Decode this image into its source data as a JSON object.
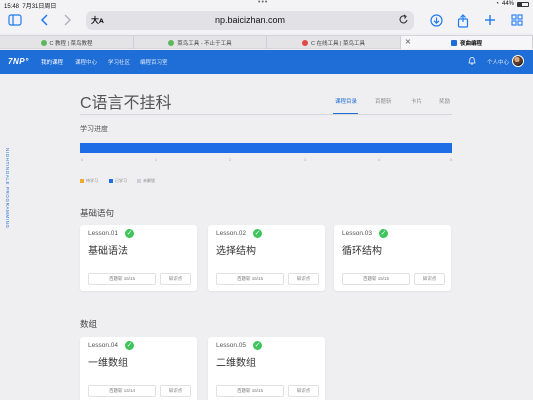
{
  "status_bar": {
    "time": "15:48",
    "date": "7月31日周日",
    "battery": "44%",
    "battery_level": 0.44
  },
  "browser": {
    "url_aa": "大ᴀ",
    "host": "np.baicizhan.com",
    "icons": [
      "sidebar-icon",
      "back-icon",
      "forward-icon",
      "reload-icon",
      "download-icon",
      "share-icon",
      "new-tab-icon",
      "tabs-grid-icon"
    ]
  },
  "tabs": [
    {
      "label": "C 教程 | 菜鸟教程",
      "active": false
    },
    {
      "label": "菜鸟工具 - 不止于工具",
      "active": false
    },
    {
      "label": "C 在线工具 | 菜鸟工具",
      "active": false
    },
    {
      "label": "夜曲编程",
      "active": true
    }
  ],
  "site_nav": {
    "logo": "7NP°",
    "items": [
      "我的课程",
      "课程中心",
      "学习社区",
      "编程百习室"
    ],
    "user_center": "个人中心"
  },
  "side_brand": "NIGHTINGALE PROGRAMMING",
  "course": {
    "title": "C语言不挂科",
    "tabs": [
      "课程目录",
      "百题斩",
      "卡片",
      "奖励"
    ],
    "progress_label": "学习进度",
    "progress_ticks": [
      "0",
      "1",
      "2",
      "3",
      "4",
      "5"
    ],
    "progress_value": 1.0,
    "legend": [
      {
        "label": "待学习",
        "color": "#f0a830"
      },
      {
        "label": "已学习",
        "color": "#1e6ce6"
      },
      {
        "label": "未解锁",
        "color": "#d0d0d4"
      }
    ]
  },
  "sections": [
    {
      "title": "基础语句",
      "lessons": [
        {
          "code": "Lesson.01",
          "name": "基础语法",
          "score": "百题斩 15/15",
          "points": "知识点"
        },
        {
          "code": "Lesson.02",
          "name": "选择结构",
          "score": "百题斩 15/15",
          "points": "知识点"
        },
        {
          "code": "Lesson.03",
          "name": "循环结构",
          "score": "百题斩 15/15",
          "points": "知识点"
        }
      ]
    },
    {
      "title": "数组",
      "lessons": [
        {
          "code": "Lesson.04",
          "name": "一维数组",
          "score": "百题斩 14/14",
          "points": "知识点"
        },
        {
          "code": "Lesson.05",
          "name": "二维数组",
          "score": "百题斩 15/15",
          "points": "知识点"
        }
      ]
    }
  ]
}
